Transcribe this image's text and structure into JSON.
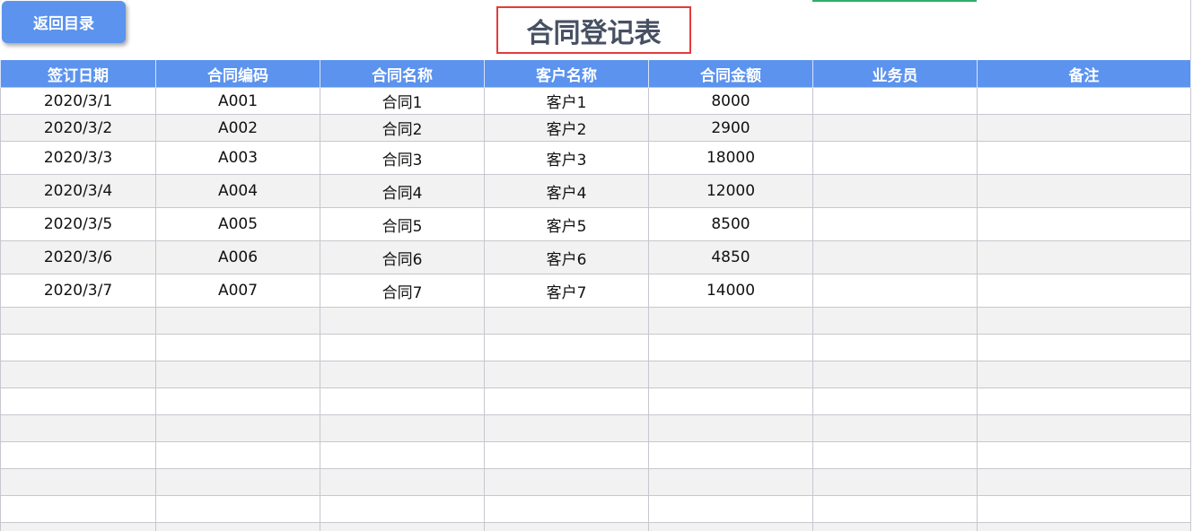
{
  "toolbar": {
    "back_label": "返回目录"
  },
  "title": "合同登记表",
  "colors": {
    "header_bg": "#5b93ee",
    "title_border": "#e53b3b",
    "title_text": "#475063",
    "row_alt": "#f2f2f2"
  },
  "table": {
    "headers": [
      "签订日期",
      "合同编码",
      "合同名称",
      "客户名称",
      "合同金额",
      "业务员",
      "备注"
    ],
    "rows": [
      [
        "2020/3/1",
        "A001",
        "合同1",
        "客户1",
        "8000",
        "",
        ""
      ],
      [
        "2020/3/2",
        "A002",
        "合同2",
        "客户2",
        "2900",
        "",
        ""
      ],
      [
        "2020/3/3",
        "A003",
        "合同3",
        "客户3",
        "18000",
        "",
        ""
      ],
      [
        "2020/3/4",
        "A004",
        "合同4",
        "客户4",
        "12000",
        "",
        ""
      ],
      [
        "2020/3/5",
        "A005",
        "合同5",
        "客户5",
        "8500",
        "",
        ""
      ],
      [
        "2020/3/6",
        "A006",
        "合同6",
        "客户6",
        "4850",
        "",
        ""
      ],
      [
        "2020/3/7",
        "A007",
        "合同7",
        "客户7",
        "14000",
        "",
        ""
      ],
      [
        "",
        "",
        "",
        "",
        "",
        "",
        ""
      ],
      [
        "",
        "",
        "",
        "",
        "",
        "",
        ""
      ],
      [
        "",
        "",
        "",
        "",
        "",
        "",
        ""
      ],
      [
        "",
        "",
        "",
        "",
        "",
        "",
        ""
      ],
      [
        "",
        "",
        "",
        "",
        "",
        "",
        ""
      ],
      [
        "",
        "",
        "",
        "",
        "",
        "",
        ""
      ],
      [
        "",
        "",
        "",
        "",
        "",
        "",
        ""
      ],
      [
        "",
        "",
        "",
        "",
        "",
        "",
        ""
      ],
      [
        "",
        "",
        "",
        "",
        "",
        "",
        ""
      ]
    ]
  }
}
